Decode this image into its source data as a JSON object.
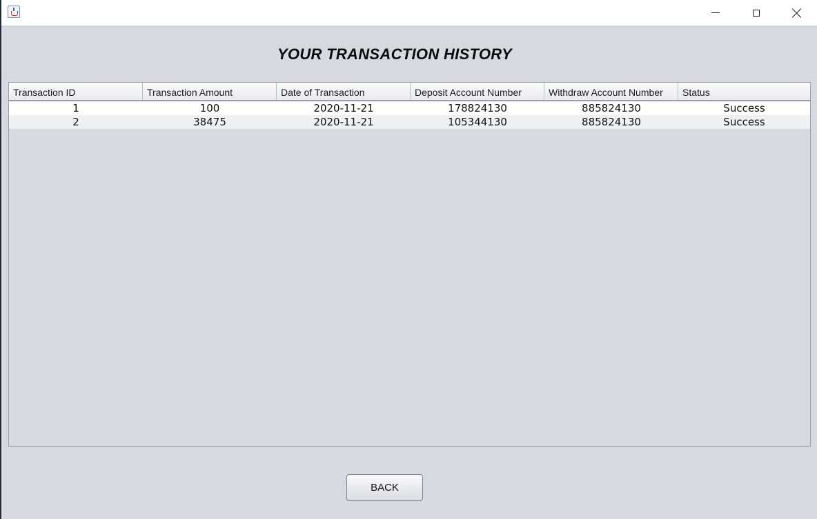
{
  "window": {
    "icon": "java-cup-icon"
  },
  "heading": "YOUR TRANSACTION HISTORY",
  "table": {
    "columns": [
      "Transaction ID",
      "Transaction Amount",
      "Date of Transaction",
      "Deposit Account Number",
      "Withdraw Account Number",
      "Status"
    ],
    "rows": [
      [
        "1",
        "100",
        "2020-11-21",
        "178824130",
        "885824130",
        "Success"
      ],
      [
        "2",
        "38475",
        "2020-11-21",
        "105344130",
        "885824130",
        "Success"
      ]
    ]
  },
  "back_button": "BACK"
}
